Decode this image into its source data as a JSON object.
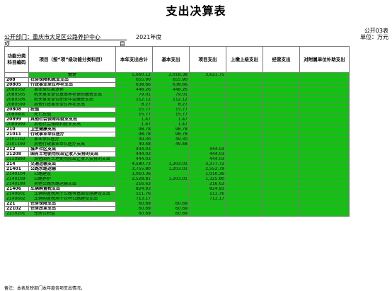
{
  "title": "支出决算表",
  "form_no": "公开03表",
  "unit": "单位：万元",
  "department": "公开部门：重庆市大足区公路养护中心",
  "year": "2021年度",
  "subheader": {
    "left": "项",
    "right": "目"
  },
  "columns": [
    "功能分类科目编码",
    "项目（按“项”级功能分类科目）",
    "本年支出合计",
    "基本支出",
    "项目支出",
    "上缴上级支出",
    "经营支出",
    "对附属单位补助支出"
  ],
  "total_label": "合计",
  "total_values": [
    "5,660.12",
    "2,018.38",
    "3,621.75"
  ],
  "rows": [
    {
      "code": "208",
      "name": "社会保障和就业支出",
      "level": "cat",
      "vals": [
        "655.90",
        "655.90",
        ""
      ]
    },
    {
      "code": "20805",
      "name": "行政事业单位养老支出",
      "level": "cat",
      "vals": [
        "638.66",
        "638.66",
        ""
      ]
    },
    {
      "code": "2080502",
      "name": "事业单位离退休",
      "level": "sub",
      "vals": [
        "448.26",
        "448.26",
        ""
      ]
    },
    {
      "code": "2080505",
      "name": "机关事业单位基本养老保险缴费支出",
      "level": "sub",
      "vals": [
        "79.01",
        "79.01",
        ""
      ]
    },
    {
      "code": "2080506",
      "name": "机关事业单位职业年金缴费支出",
      "level": "sub",
      "vals": [
        "112.12",
        "112.12",
        ""
      ]
    },
    {
      "code": "2080599",
      "name": "其他行政事业单位养老支出",
      "level": "sub",
      "vals": [
        "8.27",
        "8.27",
        ""
      ]
    },
    {
      "code": "20808",
      "name": "抚恤",
      "level": "cat",
      "vals": [
        "15.77",
        "15.77",
        ""
      ]
    },
    {
      "code": "2080801",
      "name": "死亡抚恤",
      "level": "sub",
      "vals": [
        "15.77",
        "15.77",
        ""
      ]
    },
    {
      "code": "20899",
      "name": "其他社会保障和就业支出",
      "level": "cat",
      "vals": [
        "1.47",
        "1.47",
        ""
      ]
    },
    {
      "code": "2089999",
      "name": "其他社会保障和就业支出",
      "level": "sub",
      "vals": [
        "1.47",
        "1.47",
        ""
      ]
    },
    {
      "code": "210",
      "name": "卫生健康支出",
      "level": "cat",
      "vals": [
        "98.78",
        "98.78",
        ""
      ]
    },
    {
      "code": "21011",
      "name": "行政事业单位医疗",
      "level": "cat",
      "vals": [
        "98.78",
        "98.78",
        ""
      ]
    },
    {
      "code": "2101102",
      "name": "事业单位医疗",
      "level": "sub",
      "vals": [
        "49.30",
        "49.30",
        ""
      ]
    },
    {
      "code": "2101199",
      "name": "其他行政事业单位医疗支出",
      "level": "sub",
      "vals": [
        "49.48",
        "49.48",
        ""
      ]
    },
    {
      "code": "212",
      "name": "城乡社区支出",
      "level": "cat",
      "vals": [
        "444.03",
        "",
        "444.03"
      ]
    },
    {
      "code": "21208",
      "name": "国有土地使用权出让收入安排的支出",
      "level": "cat",
      "vals": [
        "444.03",
        "",
        "444.03"
      ]
    },
    {
      "code": "2120899",
      "name": "其他国有土地使用权出让收入安排的支出",
      "level": "sub",
      "vals": [
        "444.03",
        "",
        "444.03"
      ]
    },
    {
      "code": "214",
      "name": "交通运输支出",
      "level": "cat",
      "vals": [
        "4,580.73",
        "1,203.01",
        "3,377.72"
      ]
    },
    {
      "code": "21401",
      "name": "公路水路运输",
      "level": "cat",
      "vals": [
        "3,755.80",
        "1,203.01",
        "2,552.79"
      ]
    },
    {
      "code": "2140104",
      "name": "公路建设",
      "level": "sub",
      "vals": [
        "1,010.36",
        "",
        "1,010.36"
      ]
    },
    {
      "code": "2140109",
      "name": "公路养护",
      "level": "sub",
      "vals": [
        "2,528.81",
        "1,203.01",
        "1,325.80"
      ]
    },
    {
      "code": "2140199",
      "name": "其他公路水路运输支出",
      "level": "sub",
      "vals": [
        "216.63",
        "",
        "216.63"
      ]
    },
    {
      "code": "21406",
      "name": "车辆购置税支出",
      "level": "cat",
      "vals": [
        "824.93",
        "",
        "824.93"
      ]
    },
    {
      "code": "2140601",
      "name": "车辆购置税用于公路等基础设施建设支出",
      "level": "sub",
      "vals": [
        "111.76",
        "",
        "111.76"
      ]
    },
    {
      "code": "2140602",
      "name": "车辆购置税用于农村公路建设支出",
      "level": "sub",
      "vals": [
        "713.17",
        "",
        "713.17"
      ]
    },
    {
      "code": "221",
      "name": "住房保障支出",
      "level": "cat",
      "vals": [
        "60.69",
        "60.69",
        ""
      ]
    },
    {
      "code": "22102",
      "name": "住房改革支出",
      "level": "cat",
      "vals": [
        "60.69",
        "60.69",
        ""
      ]
    },
    {
      "code": "2210201",
      "name": "住房公积金",
      "level": "sub",
      "vals": [
        "60.69",
        "60.69",
        ""
      ]
    }
  ],
  "note": "备注：本表反映部门本年度各项支出情况。",
  "colors": {
    "highlight": "#0ac70a",
    "cat_row": "#ffffff"
  }
}
